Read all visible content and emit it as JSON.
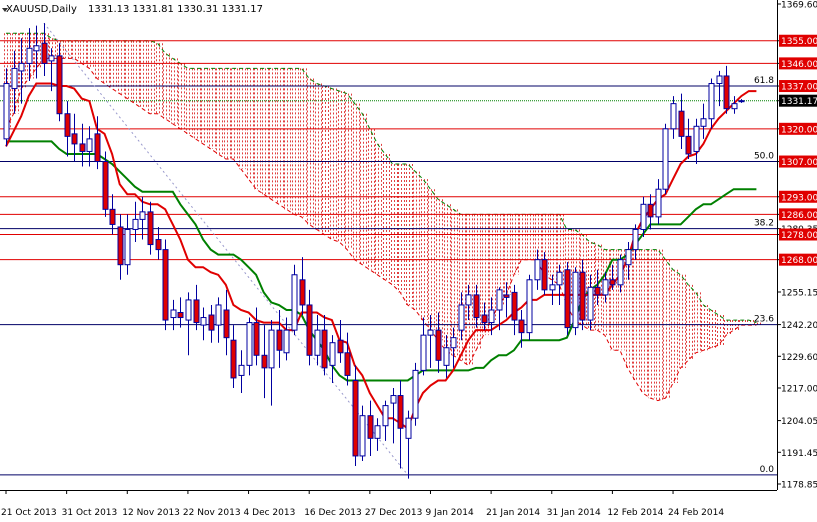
{
  "header": {
    "symbol": "XAUUSD,Daily",
    "ohlc": "1331.13 1331.81 1330.31 1331.17"
  },
  "colors": {
    "bull": "#ffffff",
    "bear": "#e00000",
    "candle_outline": "#0000a0",
    "tenkan": "#e00000",
    "kijun": "#008000",
    "cloud_upper": "#008000",
    "cloud_lower": "#e00000",
    "cloud_fill": "#e04040",
    "level_line": "#e00000",
    "fib_line": "#000066",
    "ma_line": "#008000",
    "current_price_bg": "#000000",
    "price_tag_bg": "#e00000"
  },
  "chart_data": {
    "type": "candlestick",
    "title": "XAUUSD,Daily",
    "ylim": [
      1178.85,
      1369.6
    ],
    "y_ticks": [
      "1369.60",
      "1355.00",
      "1346.00",
      "1337.00",
      "1331.17",
      "1320.00",
      "1307.00",
      "1293.00",
      "1286.00",
      "1280.35",
      "1278.00",
      "1268.00",
      "1255.15",
      "1242.20",
      "1229.60",
      "1217.00",
      "1204.05",
      "1191.45",
      "1178.85"
    ],
    "x_tick_labels": [
      "21 Oct 2013",
      "31 Oct 2013",
      "12 Nov 2013",
      "22 Nov 2013",
      "4 Dec 2013",
      "16 Dec 2013",
      "27 Dec 2013",
      "9 Jan 2014",
      "21 Jan 2014",
      "31 Jan 2014",
      "12 Feb 2014",
      "24 Feb 2014"
    ],
    "x_tick_index": [
      0,
      8,
      16,
      24,
      32,
      40,
      48,
      56,
      64,
      72,
      80,
      88
    ],
    "current_price": 1331.17,
    "resistance_support_levels": [
      1355.0,
      1346.0,
      1337.0,
      1320.0,
      1307.0,
      1293.0,
      1286.0,
      1278.0,
      1268.0
    ],
    "fibonacci_levels": [
      {
        "label": "61.8",
        "price": 1337.0
      },
      {
        "label": "50.0",
        "price": 1307.0
      },
      {
        "label": "38.2",
        "price": 1280.35
      },
      {
        "label": "23.6",
        "price": 1242.2
      },
      {
        "label": "0.0",
        "price": 1182.5
      }
    ],
    "candles": [
      {
        "o": 1316.0,
        "h": 1344.0,
        "l": 1313.0,
        "c": 1338.0
      },
      {
        "o": 1336.0,
        "h": 1351.0,
        "l": 1326.0,
        "c": 1344.0
      },
      {
        "o": 1343.0,
        "h": 1356.0,
        "l": 1330.0,
        "c": 1346.0
      },
      {
        "o": 1346.0,
        "h": 1360.0,
        "l": 1339.0,
        "c": 1352.0
      },
      {
        "o": 1351.0,
        "h": 1361.0,
        "l": 1340.0,
        "c": 1353.0
      },
      {
        "o": 1354.0,
        "h": 1362.0,
        "l": 1341.0,
        "c": 1346.0
      },
      {
        "o": 1347.0,
        "h": 1352.0,
        "l": 1335.0,
        "c": 1349.0
      },
      {
        "o": 1349.0,
        "h": 1354.0,
        "l": 1323.0,
        "c": 1326.0
      },
      {
        "o": 1326.0,
        "h": 1331.0,
        "l": 1309.0,
        "c": 1317.0
      },
      {
        "o": 1318.0,
        "h": 1326.0,
        "l": 1307.0,
        "c": 1314.0
      },
      {
        "o": 1314.0,
        "h": 1322.0,
        "l": 1305.0,
        "c": 1311.0
      },
      {
        "o": 1311.0,
        "h": 1321.0,
        "l": 1305.0,
        "c": 1316.0
      },
      {
        "o": 1318.0,
        "h": 1325.0,
        "l": 1304.0,
        "c": 1307.0
      },
      {
        "o": 1307.0,
        "h": 1311.0,
        "l": 1285.0,
        "c": 1288.0
      },
      {
        "o": 1288.0,
        "h": 1294.0,
        "l": 1278.0,
        "c": 1282.0
      },
      {
        "o": 1281.0,
        "h": 1286.0,
        "l": 1260.0,
        "c": 1266.0
      },
      {
        "o": 1266.0,
        "h": 1286.0,
        "l": 1262.0,
        "c": 1280.0
      },
      {
        "o": 1280.0,
        "h": 1291.0,
        "l": 1275.0,
        "c": 1284.0
      },
      {
        "o": 1284.0,
        "h": 1293.0,
        "l": 1276.0,
        "c": 1287.0
      },
      {
        "o": 1287.0,
        "h": 1291.0,
        "l": 1270.0,
        "c": 1274.0
      },
      {
        "o": 1276.0,
        "h": 1281.0,
        "l": 1268.0,
        "c": 1272.0
      },
      {
        "o": 1272.0,
        "h": 1276.0,
        "l": 1240.0,
        "c": 1244.0
      },
      {
        "o": 1245.0,
        "h": 1252.0,
        "l": 1240.0,
        "c": 1248.0
      },
      {
        "o": 1247.0,
        "h": 1253.0,
        "l": 1241.0,
        "c": 1245.0
      },
      {
        "o": 1244.0,
        "h": 1255.0,
        "l": 1230.0,
        "c": 1252.0
      },
      {
        "o": 1252.0,
        "h": 1258.0,
        "l": 1240.0,
        "c": 1243.0
      },
      {
        "o": 1242.0,
        "h": 1249.0,
        "l": 1236.0,
        "c": 1245.0
      },
      {
        "o": 1246.0,
        "h": 1250.0,
        "l": 1235.0,
        "c": 1240.0
      },
      {
        "o": 1242.0,
        "h": 1253.0,
        "l": 1235.0,
        "c": 1250.0
      },
      {
        "o": 1248.0,
        "h": 1256.0,
        "l": 1230.0,
        "c": 1237.0
      },
      {
        "o": 1236.0,
        "h": 1242.0,
        "l": 1217.0,
        "c": 1221.0
      },
      {
        "o": 1222.0,
        "h": 1232.0,
        "l": 1215.0,
        "c": 1226.0
      },
      {
        "o": 1226.0,
        "h": 1245.0,
        "l": 1222.0,
        "c": 1243.0
      },
      {
        "o": 1243.0,
        "h": 1249.0,
        "l": 1226.0,
        "c": 1230.0
      },
      {
        "o": 1230.0,
        "h": 1242.0,
        "l": 1213.0,
        "c": 1225.0
      },
      {
        "o": 1225.0,
        "h": 1244.0,
        "l": 1210.0,
        "c": 1240.0
      },
      {
        "o": 1240.0,
        "h": 1248.0,
        "l": 1225.0,
        "c": 1232.0
      },
      {
        "o": 1231.0,
        "h": 1245.0,
        "l": 1228.0,
        "c": 1240.0
      },
      {
        "o": 1240.0,
        "h": 1266.0,
        "l": 1238.0,
        "c": 1262.0
      },
      {
        "o": 1260.0,
        "h": 1269.0,
        "l": 1246.0,
        "c": 1250.0
      },
      {
        "o": 1250.0,
        "h": 1256.0,
        "l": 1226.0,
        "c": 1230.0
      },
      {
        "o": 1230.0,
        "h": 1246.0,
        "l": 1226.0,
        "c": 1240.0
      },
      {
        "o": 1240.0,
        "h": 1246.0,
        "l": 1222.0,
        "c": 1225.0
      },
      {
        "o": 1226.0,
        "h": 1238.0,
        "l": 1219.0,
        "c": 1235.0
      },
      {
        "o": 1236.0,
        "h": 1244.0,
        "l": 1227.0,
        "c": 1231.0
      },
      {
        "o": 1231.0,
        "h": 1239.0,
        "l": 1218.0,
        "c": 1222.0
      },
      {
        "o": 1220.0,
        "h": 1226.0,
        "l": 1186.0,
        "c": 1190.0
      },
      {
        "o": 1190.0,
        "h": 1210.0,
        "l": 1188.0,
        "c": 1206.0
      },
      {
        "o": 1206.0,
        "h": 1212.0,
        "l": 1190.0,
        "c": 1197.0
      },
      {
        "o": 1197.0,
        "h": 1205.0,
        "l": 1192.0,
        "c": 1202.0
      },
      {
        "o": 1202.0,
        "h": 1212.0,
        "l": 1196.0,
        "c": 1210.0
      },
      {
        "o": 1211.0,
        "h": 1217.0,
        "l": 1195.0,
        "c": 1214.0
      },
      {
        "o": 1214.0,
        "h": 1220.0,
        "l": 1185.0,
        "c": 1201.0
      },
      {
        "o": 1197.0,
        "h": 1208.0,
        "l": 1181.0,
        "c": 1205.0
      },
      {
        "o": 1205.0,
        "h": 1227.0,
        "l": 1202.0,
        "c": 1224.0
      },
      {
        "o": 1224.0,
        "h": 1245.0,
        "l": 1222.0,
        "c": 1238.0
      },
      {
        "o": 1238.0,
        "h": 1246.0,
        "l": 1225.0,
        "c": 1240.0
      },
      {
        "o": 1240.0,
        "h": 1247.0,
        "l": 1223.0,
        "c": 1228.0
      },
      {
        "o": 1226.0,
        "h": 1238.0,
        "l": 1221.0,
        "c": 1233.0
      },
      {
        "o": 1233.0,
        "h": 1241.0,
        "l": 1225.0,
        "c": 1237.0
      },
      {
        "o": 1240.0,
        "h": 1255.0,
        "l": 1236.0,
        "c": 1250.0
      },
      {
        "o": 1250.0,
        "h": 1258.0,
        "l": 1244.0,
        "c": 1254.0
      },
      {
        "o": 1254.0,
        "h": 1258.0,
        "l": 1241.0,
        "c": 1245.0
      },
      {
        "o": 1246.0,
        "h": 1251.0,
        "l": 1240.0,
        "c": 1243.0
      },
      {
        "o": 1243.0,
        "h": 1253.0,
        "l": 1238.0,
        "c": 1248.0
      },
      {
        "o": 1248.0,
        "h": 1257.0,
        "l": 1240.0,
        "c": 1256.0
      },
      {
        "o": 1254.0,
        "h": 1259.0,
        "l": 1245.0,
        "c": 1253.0
      },
      {
        "o": 1255.0,
        "h": 1258.0,
        "l": 1238.0,
        "c": 1244.0
      },
      {
        "o": 1244.0,
        "h": 1248.0,
        "l": 1233.0,
        "c": 1239.0
      },
      {
        "o": 1239.0,
        "h": 1262.0,
        "l": 1236.0,
        "c": 1260.0
      },
      {
        "o": 1260.0,
        "h": 1272.0,
        "l": 1256.0,
        "c": 1268.0
      },
      {
        "o": 1268.0,
        "h": 1271.0,
        "l": 1254.0,
        "c": 1256.0
      },
      {
        "o": 1256.0,
        "h": 1262.0,
        "l": 1250.0,
        "c": 1258.0
      },
      {
        "o": 1258.0,
        "h": 1266.0,
        "l": 1250.0,
        "c": 1263.0
      },
      {
        "o": 1264.0,
        "h": 1267.0,
        "l": 1238.0,
        "c": 1241.0
      },
      {
        "o": 1241.0,
        "h": 1265.0,
        "l": 1238.0,
        "c": 1263.0
      },
      {
        "o": 1263.0,
        "h": 1268.0,
        "l": 1240.0,
        "c": 1244.0
      },
      {
        "o": 1244.0,
        "h": 1262.0,
        "l": 1240.0,
        "c": 1257.0
      },
      {
        "o": 1257.0,
        "h": 1264.0,
        "l": 1250.0,
        "c": 1254.0
      },
      {
        "o": 1254.0,
        "h": 1263.0,
        "l": 1251.0,
        "c": 1260.0
      },
      {
        "o": 1260.0,
        "h": 1266.0,
        "l": 1256.0,
        "c": 1258.0
      },
      {
        "o": 1258.0,
        "h": 1270.0,
        "l": 1255.0,
        "c": 1268.0
      },
      {
        "o": 1266.0,
        "h": 1275.0,
        "l": 1260.0,
        "c": 1272.0
      },
      {
        "o": 1272.0,
        "h": 1282.0,
        "l": 1268.0,
        "c": 1280.0
      },
      {
        "o": 1280.0,
        "h": 1293.0,
        "l": 1277.0,
        "c": 1290.0
      },
      {
        "o": 1290.0,
        "h": 1294.0,
        "l": 1280.0,
        "c": 1285.0
      },
      {
        "o": 1285.0,
        "h": 1300.0,
        "l": 1282.0,
        "c": 1296.0
      },
      {
        "o": 1296.0,
        "h": 1322.0,
        "l": 1294.0,
        "c": 1320.0
      },
      {
        "o": 1320.0,
        "h": 1333.0,
        "l": 1316.0,
        "c": 1330.0
      },
      {
        "o": 1327.0,
        "h": 1334.0,
        "l": 1312.0,
        "c": 1317.0
      },
      {
        "o": 1317.0,
        "h": 1324.0,
        "l": 1308.0,
        "c": 1310.0
      },
      {
        "o": 1311.0,
        "h": 1324.0,
        "l": 1306.0,
        "c": 1321.0
      },
      {
        "o": 1321.0,
        "h": 1330.0,
        "l": 1316.0,
        "c": 1324.0
      },
      {
        "o": 1324.0,
        "h": 1340.0,
        "l": 1320.0,
        "c": 1338.0
      },
      {
        "o": 1338.0,
        "h": 1343.0,
        "l": 1329.0,
        "c": 1341.0
      },
      {
        "o": 1341.0,
        "h": 1345.0,
        "l": 1326.0,
        "c": 1328.0
      },
      {
        "o": 1328.0,
        "h": 1333.0,
        "l": 1326.0,
        "c": 1330.0
      },
      {
        "o": 1331.13,
        "h": 1331.81,
        "l": 1330.31,
        "c": 1331.17
      }
    ],
    "tenkan": [
      1313,
      1319,
      1325,
      1333,
      1338,
      1338,
      1338,
      1337,
      1337,
      1336,
      1332,
      1331,
      1320,
      1318,
      1310,
      1298,
      1294,
      1294,
      1291,
      1290,
      1290,
      1288,
      1282,
      1276,
      1268,
      1265,
      1265,
      1263,
      1262,
      1258,
      1250,
      1248,
      1247,
      1244,
      1243,
      1243,
      1243,
      1240,
      1240,
      1247,
      1247,
      1247,
      1245,
      1244,
      1236,
      1235,
      1226,
      1222,
      1215,
      1210,
      1205,
      1205,
      1203,
      1201,
      1209,
      1215,
      1218,
      1220,
      1220,
      1224,
      1230,
      1236,
      1240,
      1240,
      1240,
      1242,
      1244,
      1247,
      1249,
      1252,
      1252,
      1254,
      1254,
      1254,
      1254,
      1254,
      1254,
      1254,
      1254,
      1254,
      1258,
      1262,
      1268,
      1278,
      1284,
      1288,
      1292,
      1294,
      1300,
      1306,
      1309,
      1310,
      1314,
      1320,
      1324,
      1327,
      1330,
      1333,
      1335,
      1335
    ],
    "kijun": [
      1315,
      1315,
      1315,
      1315,
      1315,
      1315,
      1315,
      1312,
      1310,
      1310,
      1310,
      1310,
      1310,
      1308,
      1306,
      1303,
      1300,
      1297,
      1295,
      1295,
      1295,
      1295,
      1295,
      1290,
      1286,
      1282,
      1276,
      1272,
      1270,
      1270,
      1270,
      1268,
      1265,
      1262,
      1255,
      1251,
      1250,
      1248,
      1248,
      1246,
      1240,
      1236,
      1232,
      1226,
      1222,
      1220,
      1220,
      1220,
      1220,
      1220,
      1220,
      1220,
      1220,
      1220,
      1222,
      1224,
      1224,
      1224,
      1224,
      1224,
      1224,
      1224,
      1225,
      1225,
      1228,
      1230,
      1230,
      1232,
      1236,
      1236,
      1236,
      1236,
      1236,
      1236,
      1237,
      1244,
      1252,
      1256,
      1258,
      1262,
      1268,
      1268,
      1270,
      1274,
      1278,
      1282,
      1282,
      1282,
      1282,
      1282,
      1285,
      1288,
      1290,
      1290,
      1292,
      1294,
      1296,
      1296,
      1296,
      1296
    ],
    "cloud_series": [
      {
        "name": "",
        "values": [
          1358,
          1358,
          1358,
          1358,
          1358,
          1358,
          1356,
          1355,
          1355,
          1355,
          1355,
          1355,
          1355,
          1355,
          1355,
          1355,
          1355,
          1355,
          1355,
          1355,
          1354,
          1350,
          1348,
          1346,
          1344,
          1344,
          1344,
          1344,
          1344,
          1344,
          1344,
          1344,
          1344,
          1344,
          1344,
          1344,
          1344,
          1344,
          1344,
          1344,
          1340,
          1338,
          1337,
          1336,
          1335,
          1334,
          1330,
          1326,
          1320,
          1314,
          1310,
          1306,
          1306,
          1306,
          1303,
          1300,
          1296,
          1292,
          1290,
          1288,
          1286,
          1286,
          1286,
          1286,
          1286,
          1286,
          1286,
          1286,
          1286,
          1286,
          1286,
          1286,
          1286,
          1286,
          1280,
          1280,
          1278,
          1275,
          1274,
          1272,
          1272,
          1272,
          1272,
          1272,
          1272,
          1272,
          1272,
          1268,
          1264,
          1262,
          1258,
          1255,
          1250,
          1248,
          1246,
          1244,
          1244,
          1244,
          1244,
          1243
        ]
      },
      {
        "name": "",
        "values": [
          1320,
          1326,
          1336,
          1340,
          1344,
          1348,
          1348,
          1348,
          1348,
          1348,
          1346,
          1344,
          1340,
          1338,
          1336,
          1334,
          1332,
          1330,
          1328,
          1326,
          1326,
          1324,
          1322,
          1320,
          1318,
          1316,
          1314,
          1312,
          1310,
          1308,
          1308,
          1304,
          1300,
          1296,
          1294,
          1292,
          1290,
          1288,
          1286,
          1285,
          1282,
          1280,
          1278,
          1276,
          1275,
          1272,
          1268,
          1266,
          1264,
          1262,
          1260,
          1258,
          1255,
          1250,
          1248,
          1244,
          1240,
          1236,
          1232,
          1230,
          1228,
          1226,
          1232,
          1238,
          1244,
          1250,
          1254,
          1262,
          1268,
          1268,
          1268,
          1262,
          1260,
          1258,
          1250,
          1244,
          1242,
          1240,
          1240,
          1238,
          1232,
          1232,
          1225,
          1220,
          1215,
          1213,
          1212,
          1213,
          1219,
          1225,
          1228,
          1231,
          1232,
          1233,
          1234,
          1238,
          1240,
          1242,
          1242,
          1242
        ]
      }
    ]
  }
}
